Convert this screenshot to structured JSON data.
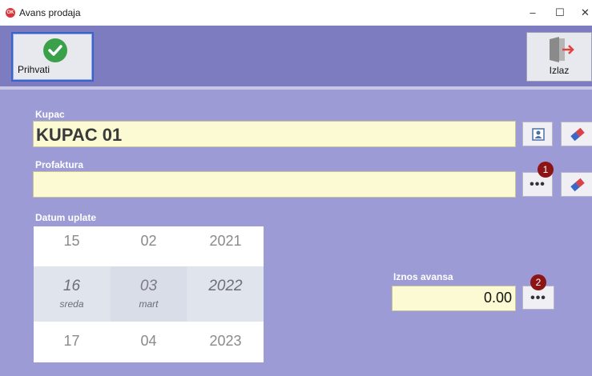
{
  "window": {
    "title": "Avans prodaja",
    "app_icon_text": "OK",
    "minimize": "–",
    "maximize": "☐",
    "close": "✕"
  },
  "toolbar": {
    "accept_label": "Prihvati",
    "exit_label": "Izlaz"
  },
  "form": {
    "kupac": {
      "label": "Kupac",
      "value": "KUPAC 01"
    },
    "profaktura": {
      "label": "Profaktura",
      "value": "",
      "badge": "1",
      "browse_label": "•••"
    },
    "datum": {
      "label": "Datum uplate",
      "rows": [
        {
          "day": "15",
          "month": "02",
          "year": "2021"
        },
        {
          "day": "16",
          "weekday": "sreda",
          "month": "03",
          "month_name": "mart",
          "year": "2022"
        },
        {
          "day": "17",
          "month": "04",
          "year": "2023"
        }
      ]
    },
    "iznos": {
      "label": "Iznos avansa",
      "value": "0.00",
      "badge": "2",
      "browse_label": "•••"
    }
  },
  "colors": {
    "background": "#9c9bd6",
    "toolbar": "#7d7cc0",
    "field": "#fcfad3",
    "badge": "#8c1414",
    "accept_green": "#3aa14a",
    "exit_red": "#e0433c"
  },
  "icons": {
    "accept": "check-circle-icon",
    "exit": "door-exit-icon",
    "kupac_lookup": "contact-card-icon",
    "clear": "eraser-icon"
  }
}
